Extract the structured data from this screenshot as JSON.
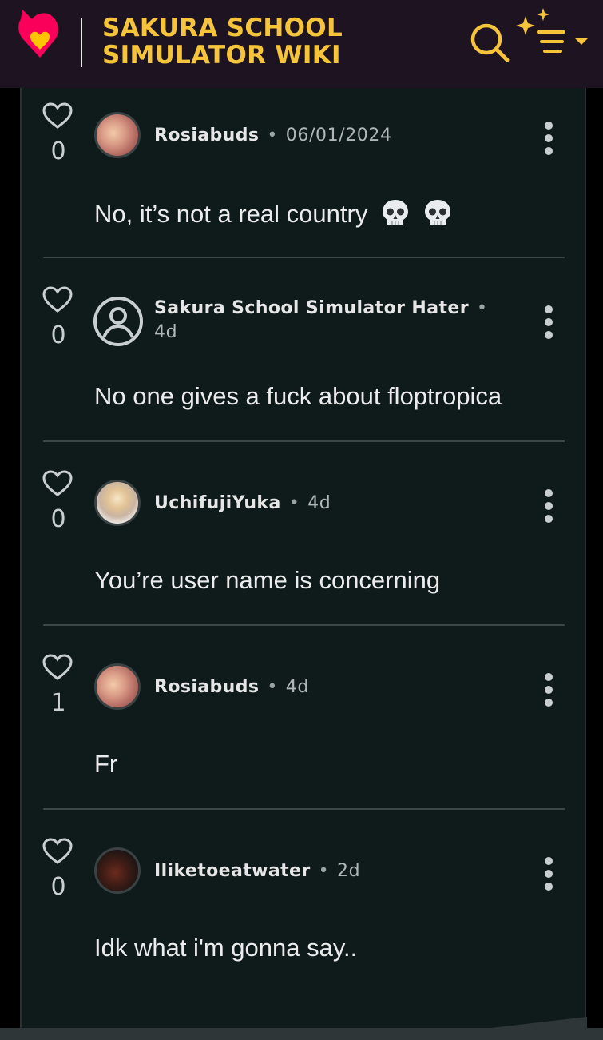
{
  "header": {
    "title_line1": "SAKURA SCHOOL",
    "title_line2": "SIMULATOR WIKI",
    "logo_icon": "fandom-heart-logo-icon",
    "search_icon": "search-icon",
    "menu_icon": "sparkle-menu-icon",
    "accent_color": "#f6c43a",
    "brand_color": "#fa005a"
  },
  "comments": [
    {
      "author": "Rosiabuds",
      "time": "06/01/2024",
      "likes": "0",
      "text": "No, it’s not a real country",
      "emoji": [
        "skull-emoji",
        "skull-emoji"
      ]
    },
    {
      "author": "Sakura School Simulator Hater",
      "time": "4d",
      "likes": "0",
      "text": "No one gives a fuck about floptropica"
    },
    {
      "author": "UchifujiYuka",
      "time": "4d",
      "likes": "0",
      "text": "You’re user name is concerning"
    },
    {
      "author": "Rosiabuds",
      "time": "4d",
      "likes": "1",
      "text": "Fr"
    },
    {
      "author": "Iliketoeatwater",
      "time": "2d",
      "likes": "0",
      "text": "Idk what i'm gonna say.."
    }
  ]
}
